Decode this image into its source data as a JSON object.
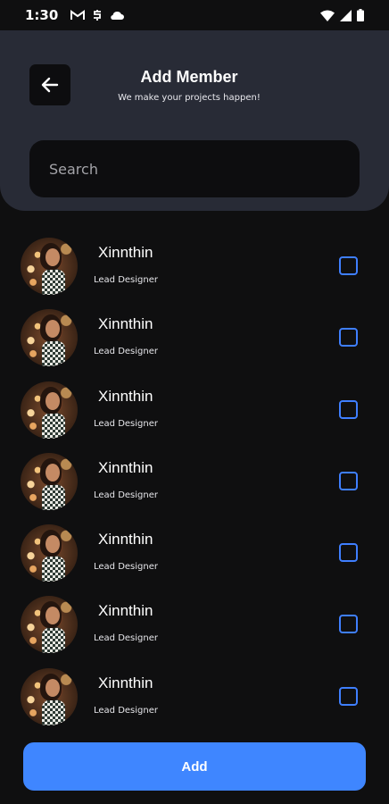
{
  "status_bar": {
    "time": "1:30",
    "left_icons": [
      "gmail-icon",
      "sync-icon",
      "cloud-icon"
    ],
    "right_icons": [
      "wifi-icon",
      "signal-icon",
      "battery-icon"
    ]
  },
  "header": {
    "title": "Add Member",
    "subtitle": "We make your projects happen!",
    "back_icon": "arrow-left-icon"
  },
  "search": {
    "placeholder": "Search",
    "value": ""
  },
  "members": [
    {
      "name": "Xinnthin",
      "role": "Lead Designer",
      "checked": false
    },
    {
      "name": "Xinnthin",
      "role": "Lead Designer",
      "checked": false
    },
    {
      "name": "Xinnthin",
      "role": "Lead Designer",
      "checked": false
    },
    {
      "name": "Xinnthin",
      "role": "Lead Designer",
      "checked": false
    },
    {
      "name": "Xinnthin",
      "role": "Lead Designer",
      "checked": false
    },
    {
      "name": "Xinnthin",
      "role": "Lead Designer",
      "checked": false
    },
    {
      "name": "Xinnthin",
      "role": "Lead Designer",
      "checked": false
    }
  ],
  "actions": {
    "add_label": "Add"
  },
  "colors": {
    "background": "#0f0f10",
    "header": "#282b36",
    "accent": "#3f86ff",
    "checkbox_border": "#3f7fff"
  }
}
